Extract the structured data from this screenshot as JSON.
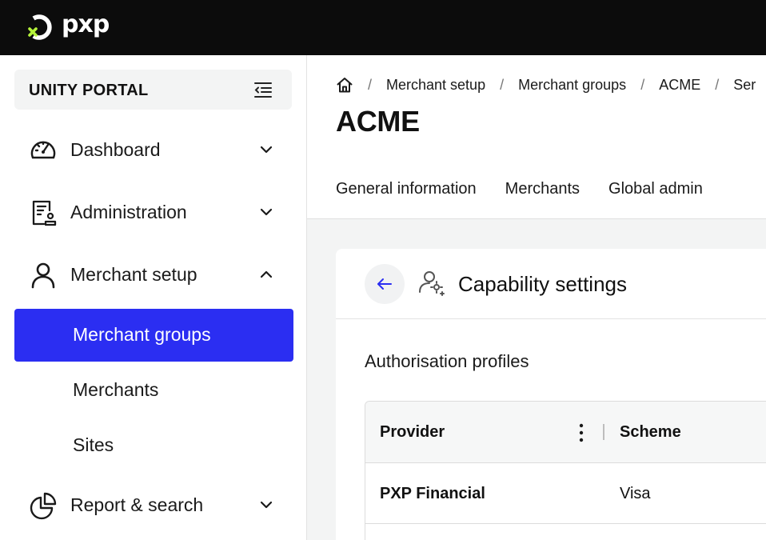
{
  "app": {
    "logo_text": "pxp",
    "portal_title": "UNITY PORTAL"
  },
  "sidebar": {
    "items": [
      {
        "label": "Dashboard",
        "icon": "gauge-icon",
        "expanded": false
      },
      {
        "label": "Administration",
        "icon": "document-user-icon",
        "expanded": false
      },
      {
        "label": "Merchant setup",
        "icon": "person-icon",
        "expanded": true
      },
      {
        "label": "Report & search",
        "icon": "pie-chart-icon",
        "expanded": false
      }
    ],
    "subitems": [
      {
        "label": "Merchant groups",
        "active": true
      },
      {
        "label": "Merchants",
        "active": false
      },
      {
        "label": "Sites",
        "active": false
      }
    ]
  },
  "breadcrumb": [
    "Merchant setup",
    "Merchant groups",
    "ACME",
    "Ser"
  ],
  "page_title": "ACME",
  "tabs": [
    "General information",
    "Merchants",
    "Global admin"
  ],
  "card": {
    "title": "Capability settings",
    "section_title": "Authorisation profiles"
  },
  "table": {
    "columns": [
      "Provider",
      "Scheme"
    ],
    "rows": [
      {
        "provider": "PXP Financial",
        "scheme": "Visa"
      }
    ]
  },
  "colors": {
    "topbar": "#0c0c0c",
    "accent": "#2b2ef2",
    "logo_accent": "#b5f23a",
    "back_arrow": "#2b2ef2"
  }
}
